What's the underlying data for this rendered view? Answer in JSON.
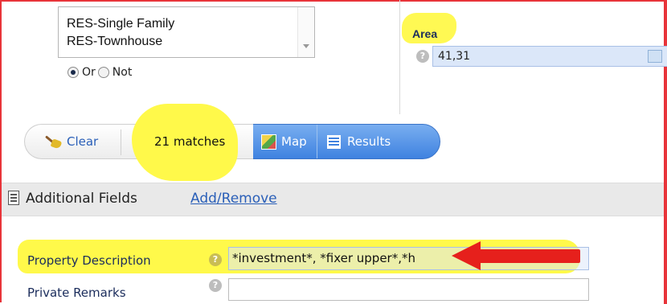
{
  "property_types": {
    "options": [
      "RES-Single Family",
      "RES-Townhouse"
    ],
    "logic": {
      "or_label": "Or",
      "not_label": "Not",
      "selected": "Or"
    }
  },
  "area": {
    "label": "Area",
    "help": "?",
    "value": "41,31"
  },
  "toolbar": {
    "clear_label": "Clear",
    "matches_text": "21 matches",
    "map_label": "Map",
    "results_label": "Results"
  },
  "additional_fields": {
    "title": "Additional Fields",
    "link_label": "Add/Remove"
  },
  "fields": {
    "property_description": {
      "label": "Property Description",
      "help": "?",
      "value": "*investment*, *fixer upper*,*h"
    },
    "private_remarks": {
      "label": "Private Remarks",
      "help": "?",
      "value": ""
    }
  },
  "colors": {
    "highlight": "#fff94a",
    "annotation_arrow": "#e6201c",
    "frame": "#e8343a",
    "button_blue": "#3f82e0",
    "link": "#2a5fb8"
  }
}
